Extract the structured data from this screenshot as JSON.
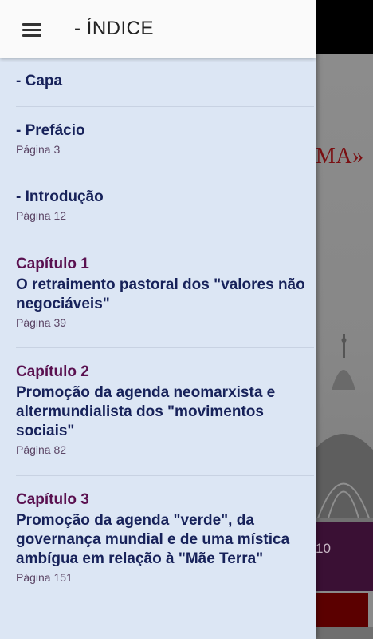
{
  "header": {
    "title": "- ÍNDICE",
    "menu_icon": "hamburger-menu-icon"
  },
  "background": {
    "title_fragment": "MA»",
    "band_text_fragment": "10"
  },
  "toc": [
    {
      "chapter": "",
      "title": "- Capa",
      "page": ""
    },
    {
      "chapter": "",
      "title": "- Prefácio",
      "page": "Página 3"
    },
    {
      "chapter": "",
      "title": "- Introdução",
      "page": "Página 12"
    },
    {
      "chapter": "Capítulo 1",
      "title": "O retraimento pastoral dos \"valores não negociáveis\"",
      "page": "Página 39"
    },
    {
      "chapter": "Capítulo 2",
      "title": "Promoção da agenda neomarxista e altermundialista dos \"movimentos sociais\"",
      "page": "Página 82"
    },
    {
      "chapter": "Capítulo 3",
      "title": "Promoção da agenda \"verde\", da governança mundial e de uma mística ambígua em relação à \"Mãe Terra\"",
      "page": "Página 151"
    }
  ],
  "colors": {
    "drawer_bg": "#dce6f4",
    "chapter_color": "#5a1150",
    "title_color": "#17225a",
    "page_color": "#5c4666"
  }
}
